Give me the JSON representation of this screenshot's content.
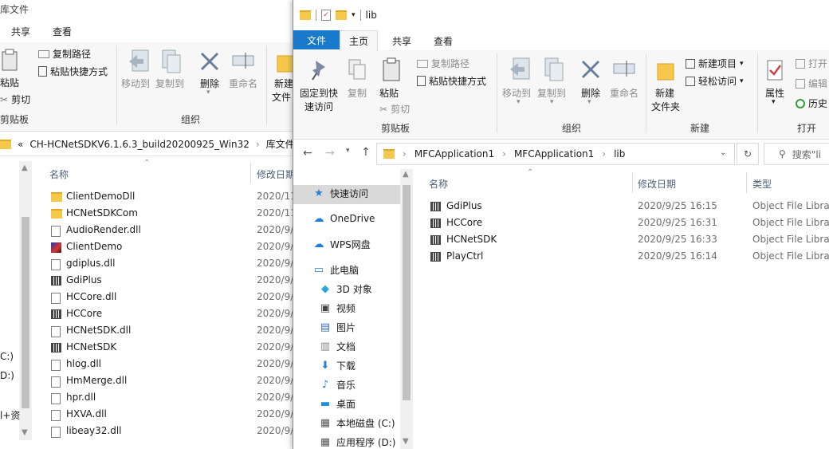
{
  "colors": {
    "accent": "#1979ca",
    "folder": "#f5c84c",
    "selected": "#cce8ff"
  },
  "back_window": {
    "title": "库文件",
    "tabs": [
      "共享",
      "查看"
    ],
    "ribbon": {
      "paste": "粘贴",
      "copy_path": "复制路径",
      "paste_shortcut": "粘贴快捷方式",
      "cut": "剪切",
      "move_to": "移动到",
      "copy_to": "复制到",
      "delete": "删除",
      "rename": "重命名",
      "new_folder_a": "新建",
      "new_folder_b": "文件",
      "group_clipboard": "剪贴板",
      "group_organize": "组织"
    },
    "breadcrumb": {
      "chevron": "«",
      "part1": "CH-HCNetSDKV6.1.6.3_build20200925_Win32",
      "sep": "›",
      "part2": "库文件"
    },
    "columns": {
      "name": "名称",
      "modified": "修改日期"
    },
    "files": [
      {
        "name": "ClientDemoDll",
        "date": "2020/11",
        "icon": "folder"
      },
      {
        "name": "HCNetSDKCom",
        "date": "2020/11",
        "icon": "folder"
      },
      {
        "name": "AudioRender.dll",
        "date": "2020/9/",
        "icon": "file"
      },
      {
        "name": "ClientDemo",
        "date": "2020/9/",
        "icon": "app"
      },
      {
        "name": "gdiplus.dll",
        "date": "2020/9/",
        "icon": "file"
      },
      {
        "name": "GdiPlus",
        "date": "2020/9/",
        "icon": "lib"
      },
      {
        "name": "HCCore.dll",
        "date": "2020/9/",
        "icon": "file"
      },
      {
        "name": "HCCore",
        "date": "2020/9/",
        "icon": "lib"
      },
      {
        "name": "HCNetSDK.dll",
        "date": "2020/9/",
        "icon": "file"
      },
      {
        "name": "HCNetSDK",
        "date": "2020/9/",
        "icon": "lib"
      },
      {
        "name": "hlog.dll",
        "date": "2020/9/",
        "icon": "file"
      },
      {
        "name": "HmMerge.dll",
        "date": "2020/9/",
        "icon": "file"
      },
      {
        "name": "hpr.dll",
        "date": "2020/9/",
        "icon": "file"
      },
      {
        "name": "HXVA.dll",
        "date": "2020/9/",
        "icon": "file"
      },
      {
        "name": "libeay32.dll",
        "date": "2020/9/",
        "icon": "file"
      }
    ],
    "left_edge": {
      "c": "C:)",
      "d": "D:)",
      "plus": "l+资"
    }
  },
  "front_window": {
    "title": "lib",
    "tabs": {
      "file": "文件",
      "home": "主页",
      "share": "共享",
      "view": "查看"
    },
    "ribbon": {
      "pin": "固定到快",
      "pin2": "速访问",
      "copy": "复制",
      "paste": "粘贴",
      "copy_path": "复制路径",
      "paste_shortcut": "粘贴快捷方式",
      "cut": "剪切",
      "move_to": "移动到",
      "copy_to": "复制到",
      "delete": "删除",
      "rename": "重命名",
      "new_folder": "新建",
      "new_folder2": "文件夹",
      "new_item": "新建项目",
      "easy_access": "轻松访问",
      "properties": "属性",
      "open": "打开",
      "edit": "编辑",
      "history": "历史",
      "group_clipboard": "剪贴板",
      "group_organize": "组织",
      "group_new": "新建",
      "group_open": "打开"
    },
    "path": [
      "MFCApplication1",
      "MFCApplication1",
      "lib"
    ],
    "search_placeholder": "搜索\"li",
    "nav": [
      {
        "label": "快速访问",
        "icon": "star-icon"
      },
      {
        "label": "OneDrive",
        "icon": "cloud-icon"
      },
      {
        "label": "WPS网盘",
        "icon": "cloud-icon"
      },
      {
        "label": "此电脑",
        "icon": "pc-icon"
      },
      {
        "label": "3D 对象",
        "icon": "cube-icon"
      },
      {
        "label": "视频",
        "icon": "video-icon"
      },
      {
        "label": "图片",
        "icon": "picture-icon"
      },
      {
        "label": "文档",
        "icon": "document-icon"
      },
      {
        "label": "下载",
        "icon": "download-icon"
      },
      {
        "label": "音乐",
        "icon": "music-icon"
      },
      {
        "label": "桌面",
        "icon": "desktop-icon"
      },
      {
        "label": "本地磁盘 (C:)",
        "icon": "disk-icon"
      },
      {
        "label": "应用程序 (D:)",
        "icon": "disk-icon"
      }
    ],
    "columns": {
      "name": "名称",
      "modified": "修改日期",
      "type": "类型"
    },
    "files": [
      {
        "name": "GdiPlus",
        "date": "2020/9/25 16:15",
        "type": "Object File Library"
      },
      {
        "name": "HCCore",
        "date": "2020/9/25 16:31",
        "type": "Object File Library"
      },
      {
        "name": "HCNetSDK",
        "date": "2020/9/25 16:33",
        "type": "Object File Library"
      },
      {
        "name": "PlayCtrl",
        "date": "2020/9/25 16:14",
        "type": "Object File Library"
      }
    ]
  }
}
